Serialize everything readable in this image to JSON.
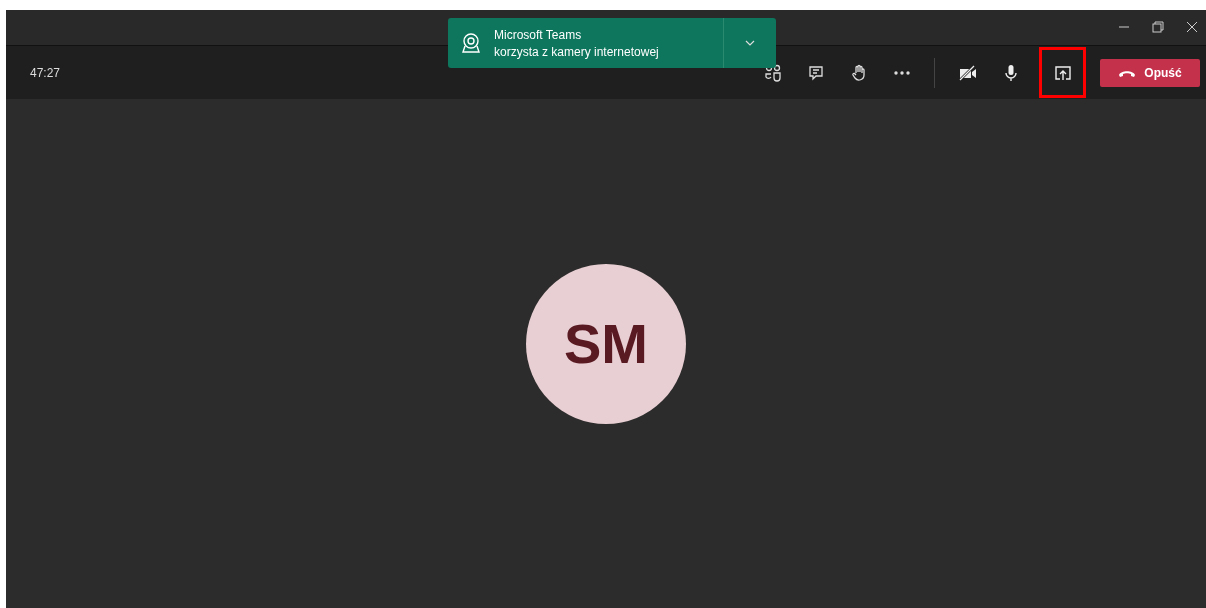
{
  "toolbar": {
    "timer": "47:27",
    "tools": [
      {
        "kind": "people",
        "highlighted": false
      },
      {
        "kind": "chat",
        "highlighted": false
      },
      {
        "kind": "hand",
        "highlighted": false
      },
      {
        "kind": "more",
        "highlighted": false
      },
      {
        "kind": "divider"
      },
      {
        "kind": "camera-off",
        "highlighted": false
      },
      {
        "kind": "mic",
        "highlighted": false
      },
      {
        "kind": "share",
        "highlighted": true
      }
    ],
    "leave_button": "Opuść"
  },
  "notification": {
    "app": "Microsoft Teams",
    "message": "korzysta z kamery internetowej"
  },
  "participant": {
    "initials": "SM"
  }
}
